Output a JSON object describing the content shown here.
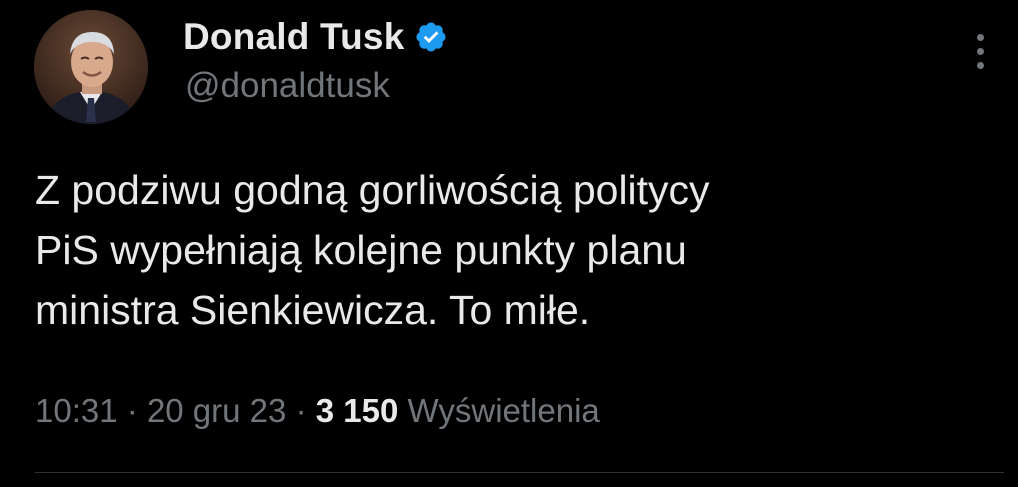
{
  "author": {
    "display_name": "Donald Tusk",
    "handle": "@donaldtusk",
    "verified": true
  },
  "tweet": {
    "lines": [
      "Z podziwu godną gorliwością politycy",
      "PiS wypełniają kolejne punkty planu",
      "ministra Sienkiewicza. To miłe."
    ]
  },
  "meta": {
    "time": "10:31",
    "separator": "·",
    "date": "20 gru 23",
    "views_count": "3 150",
    "views_label": "Wyświetlenia"
  },
  "icons": {
    "verified": "verified-badge-icon",
    "more": "more-options-icon"
  },
  "colors": {
    "background": "#000000",
    "text_primary": "#e7e9ea",
    "text_secondary": "#71767b",
    "verified_blue": "#1d9bf0"
  }
}
